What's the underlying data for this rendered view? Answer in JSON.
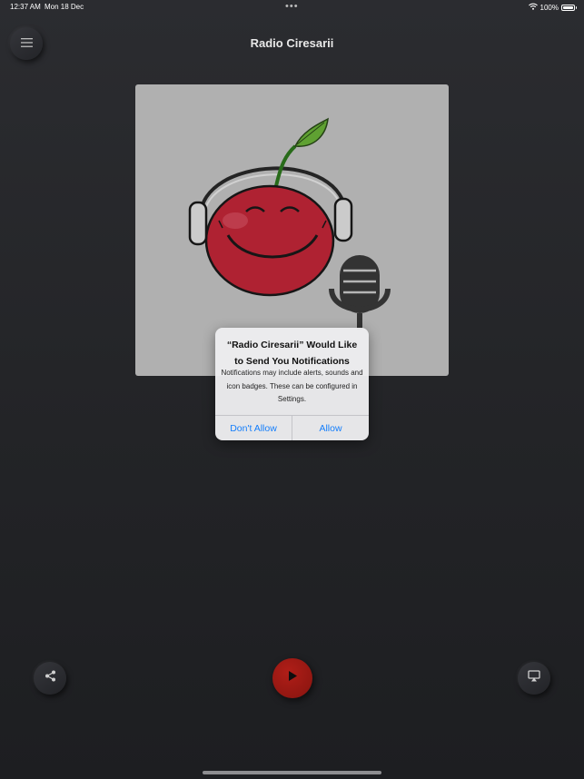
{
  "status_bar": {
    "time": "12:37 AM",
    "date": "Mon 18 Dec",
    "battery": "100%",
    "icons": [
      "wifi-icon",
      "battery-icon"
    ]
  },
  "header": {
    "title": "Radio Ciresarii",
    "menu_icon": "hamburger-icon"
  },
  "alert": {
    "title": "“Radio Ciresarii” Would Like to Send You Notifications",
    "message": "Notifications may include alerts, sounds and icon badges. These can be configured in Settings.",
    "deny_label": "Don't Allow",
    "allow_label": "Allow",
    "action_color": "#147efb"
  },
  "controls": {
    "share_icon": "share-icon",
    "play_icon": "play-icon",
    "airplay_icon": "airplay-icon",
    "play_color": "#9b1a14"
  },
  "colors": {
    "background": "#26272a",
    "accent": "#147efb"
  }
}
